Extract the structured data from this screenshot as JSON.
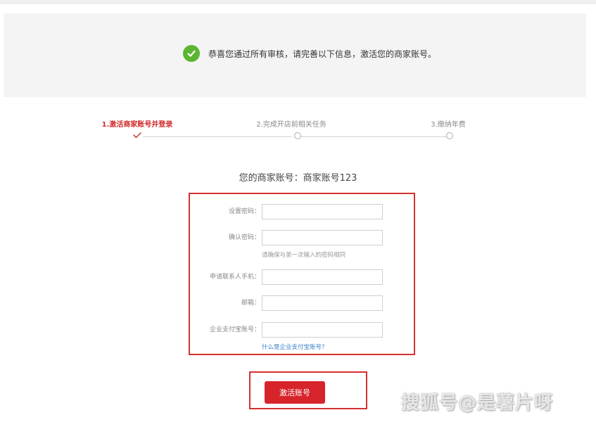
{
  "banner": {
    "icon": "check-circle-icon",
    "icon_color": "#5cb531",
    "message": "恭喜您通过所有审核，请完善以下信息，激活您的商家账号。"
  },
  "steps": [
    {
      "label": "1.激活商家账号并登录",
      "state": "done"
    },
    {
      "label": "2.完成开店前相关任务",
      "state": "pending"
    },
    {
      "label": "3.缴纳年费",
      "state": "pending"
    }
  ],
  "account": {
    "text": "您的商家账号：商家账号123"
  },
  "form": {
    "password": {
      "label": "设置密码：",
      "value": ""
    },
    "confirm_password": {
      "label": "确认密码：",
      "value": "",
      "hint": "请确保与第一次输入的密码相同"
    },
    "phone": {
      "label": "申请联系人手机：",
      "value": ""
    },
    "email": {
      "label": "邮箱：",
      "value": ""
    },
    "alipay": {
      "label": "企业支付宝账号：",
      "value": "",
      "help_link": "什么是企业支付宝账号？"
    }
  },
  "submit": {
    "label": "激活账号"
  },
  "watermark": "搜狐号@是薯片呀",
  "colors": {
    "accent_red": "#d6242a",
    "highlight_border": "#d43030",
    "link_blue": "#3a7fc8"
  }
}
